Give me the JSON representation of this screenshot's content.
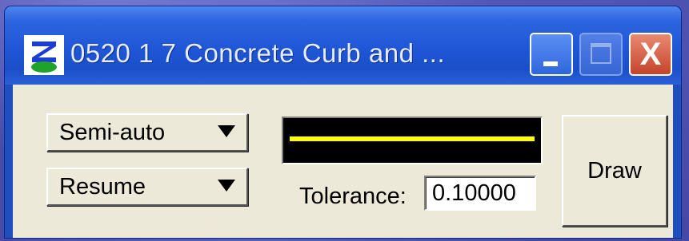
{
  "window": {
    "title": "0520  1  7 Concrete Curb and ...",
    "icon": "app-logo-icon",
    "buttons": {
      "minimize_icon": "minimize-icon",
      "maximize_icon": "maximize-icon",
      "close_label": "X"
    }
  },
  "controls": {
    "mode_dropdown": {
      "selected": "Semi-auto",
      "icon": "chevron-down-icon"
    },
    "resume_dropdown": {
      "selected": "Resume",
      "icon": "chevron-down-icon"
    },
    "line_preview": {
      "background": "#000000",
      "line_color": "#ffff00"
    },
    "tolerance": {
      "label": "Tolerance:",
      "value": "0.10000"
    },
    "draw_label": "Draw"
  },
  "colors": {
    "title_bar": "#1f56d6",
    "client_background": "#ece9d8",
    "close_button": "#c4442a"
  }
}
